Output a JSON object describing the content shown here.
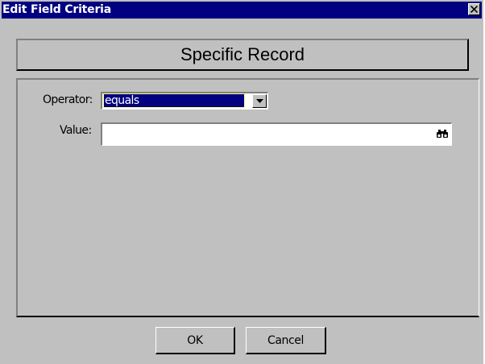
{
  "window": {
    "title": "Edit Field Criteria",
    "close_icon": "close-icon"
  },
  "header": {
    "heading": "Specific Record"
  },
  "form": {
    "operator_label": "Operator:",
    "operator_value": "equals",
    "value_label": "Value:",
    "value_input": "",
    "lookup_icon": "binoculars-icon"
  },
  "buttons": {
    "ok_label": "OK",
    "cancel_label": "Cancel"
  },
  "colors": {
    "titlebar": "#000080",
    "face": "#c0c0c0",
    "selection": "#000080"
  }
}
